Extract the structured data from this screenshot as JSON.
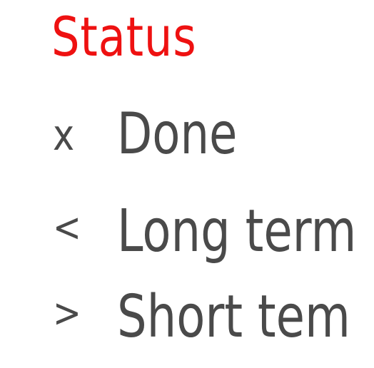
{
  "legend": {
    "title": "Status",
    "items": [
      {
        "symbol": "x",
        "label": "Done"
      },
      {
        "symbol": "<",
        "label": "Long term"
      },
      {
        "symbol": ">",
        "label": "Short tem"
      }
    ]
  },
  "colors": {
    "title": "#ee1111",
    "text": "#4a4a4a",
    "background": "#ffffff"
  }
}
